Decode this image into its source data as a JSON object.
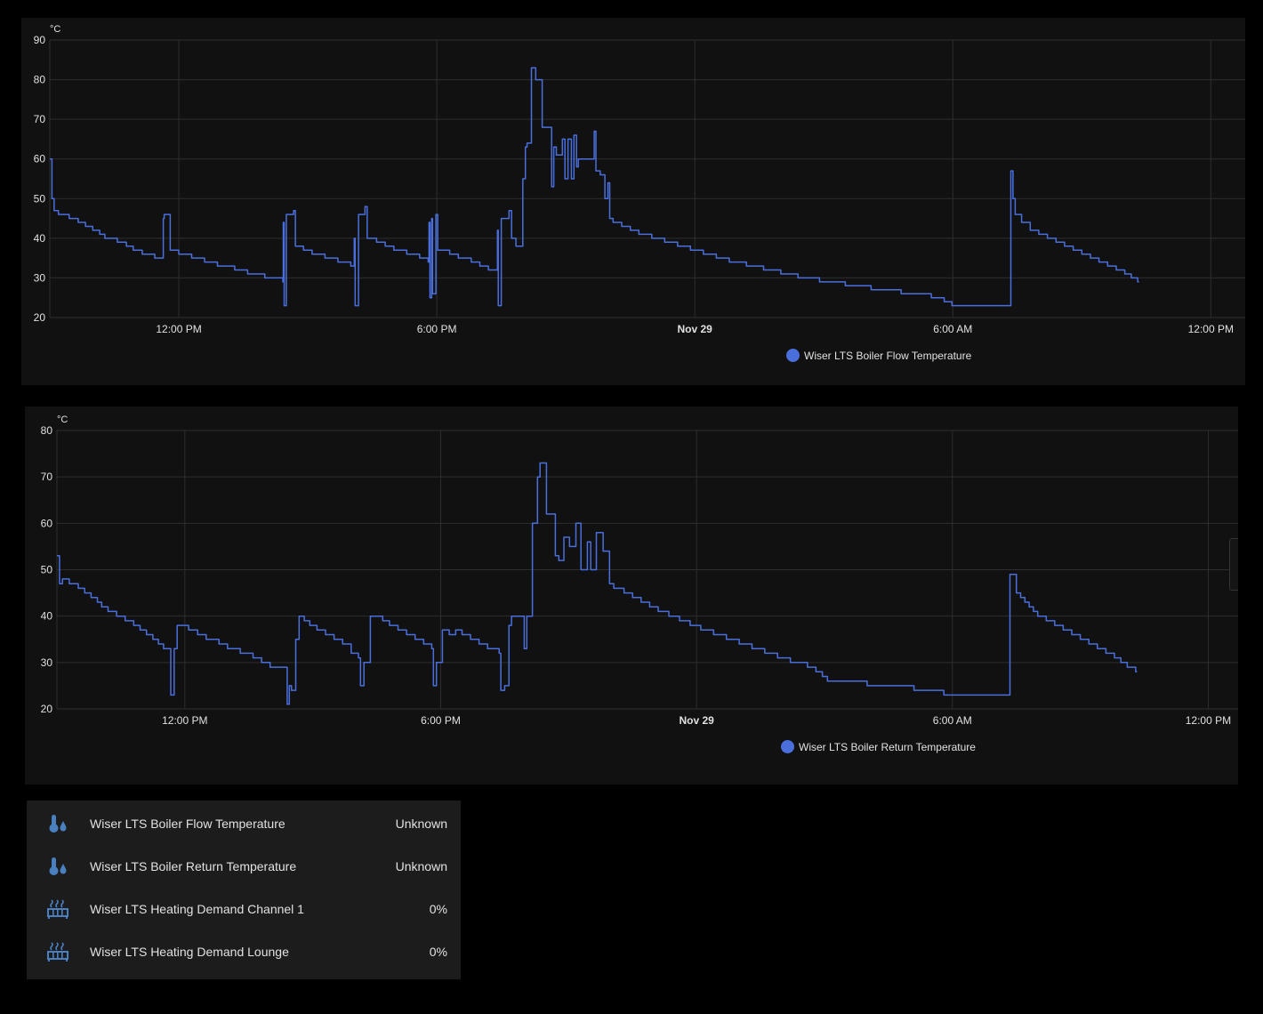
{
  "colors": {
    "series": "#4a6fdc",
    "grid": "#2e2e2e",
    "axis_text": "#e1e1e1",
    "icon": "#4a80c0"
  },
  "chart_data": [
    {
      "type": "line",
      "title": "",
      "ylabel": "°C",
      "ylim": [
        20,
        90
      ],
      "yticks": [
        20,
        30,
        40,
        50,
        60,
        70,
        80,
        90
      ],
      "x_unit": "hours since Nov 28 9:00 AM",
      "xlim": [
        0,
        27.8
      ],
      "xticks": [
        {
          "h": 3,
          "label": "12:00 PM",
          "bold": false
        },
        {
          "h": 9,
          "label": "6:00 PM",
          "bold": false
        },
        {
          "h": 15,
          "label": "Nov 29",
          "bold": true
        },
        {
          "h": 21,
          "label": "6:00 AM",
          "bold": false
        },
        {
          "h": 27,
          "label": "12:00 PM",
          "bold": false
        }
      ],
      "legend": "bottom-center",
      "series": [
        {
          "name": "Wiser LTS Boiler Flow Temperature",
          "points": [
            [
              0,
              60
            ],
            [
              0.05,
              50
            ],
            [
              0.1,
              47
            ],
            [
              0.2,
              46
            ],
            [
              0.45,
              45
            ],
            [
              0.66,
              44
            ],
            [
              0.83,
              43
            ],
            [
              1.0,
              42
            ],
            [
              1.16,
              41
            ],
            [
              1.28,
              40
            ],
            [
              1.57,
              39
            ],
            [
              1.78,
              38
            ],
            [
              1.94,
              37
            ],
            [
              2.15,
              36
            ],
            [
              2.44,
              35
            ],
            [
              2.64,
              45
            ],
            [
              2.66,
              46
            ],
            [
              2.8,
              37
            ],
            [
              3.0,
              36
            ],
            [
              3.3,
              35
            ],
            [
              3.6,
              34
            ],
            [
              3.9,
              33
            ],
            [
              4.3,
              32
            ],
            [
              4.6,
              31
            ],
            [
              5.0,
              30
            ],
            [
              5.42,
              29
            ],
            [
              5.43,
              44
            ],
            [
              5.45,
              23
            ],
            [
              5.5,
              46
            ],
            [
              5.67,
              47
            ],
            [
              5.71,
              38
            ],
            [
              5.9,
              37
            ],
            [
              6.1,
              36
            ],
            [
              6.4,
              35
            ],
            [
              6.7,
              34
            ],
            [
              7.0,
              33
            ],
            [
              7.08,
              40
            ],
            [
              7.1,
              23
            ],
            [
              7.18,
              46
            ],
            [
              7.33,
              48
            ],
            [
              7.38,
              40
            ],
            [
              7.6,
              39
            ],
            [
              7.8,
              38
            ],
            [
              8.0,
              37
            ],
            [
              8.3,
              36
            ],
            [
              8.6,
              35
            ],
            [
              8.8,
              34
            ],
            [
              8.82,
              44
            ],
            [
              8.84,
              25
            ],
            [
              8.88,
              45
            ],
            [
              8.9,
              26
            ],
            [
              8.98,
              46
            ],
            [
              9.02,
              37
            ],
            [
              9.3,
              36
            ],
            [
              9.5,
              35
            ],
            [
              9.8,
              34
            ],
            [
              10.0,
              33
            ],
            [
              10.2,
              32
            ],
            [
              10.41,
              42
            ],
            [
              10.43,
              23
            ],
            [
              10.5,
              45
            ],
            [
              10.68,
              47
            ],
            [
              10.74,
              40
            ],
            [
              10.84,
              38
            ],
            [
              11.0,
              55
            ],
            [
              11.06,
              63
            ],
            [
              11.1,
              64
            ],
            [
              11.2,
              83
            ],
            [
              11.27,
              83
            ],
            [
              11.3,
              80
            ],
            [
              11.45,
              68
            ],
            [
              11.67,
              53
            ],
            [
              11.72,
              63
            ],
            [
              11.78,
              61
            ],
            [
              11.92,
              65
            ],
            [
              11.98,
              55
            ],
            [
              12.05,
              65
            ],
            [
              12.13,
              55
            ],
            [
              12.19,
              66
            ],
            [
              12.25,
              58
            ],
            [
              12.29,
              60
            ],
            [
              12.5,
              60
            ],
            [
              12.66,
              67
            ],
            [
              12.7,
              57
            ],
            [
              12.8,
              56
            ],
            [
              12.91,
              50
            ],
            [
              12.98,
              54
            ],
            [
              13.02,
              45
            ],
            [
              13.1,
              44
            ],
            [
              13.3,
              43
            ],
            [
              13.5,
              42
            ],
            [
              13.7,
              41
            ],
            [
              14.0,
              40
            ],
            [
              14.3,
              39
            ],
            [
              14.6,
              38
            ],
            [
              14.9,
              37
            ],
            [
              15.2,
              36
            ],
            [
              15.5,
              35
            ],
            [
              15.8,
              34
            ],
            [
              16.2,
              33
            ],
            [
              16.6,
              32
            ],
            [
              17.0,
              31
            ],
            [
              17.4,
              30
            ],
            [
              17.9,
              29
            ],
            [
              18.5,
              28
            ],
            [
              19.1,
              27
            ],
            [
              19.8,
              26
            ],
            [
              20.5,
              25
            ],
            [
              20.8,
              24
            ],
            [
              20.98,
              23
            ],
            [
              22.33,
              23
            ],
            [
              22.35,
              57
            ],
            [
              22.4,
              50
            ],
            [
              22.45,
              46
            ],
            [
              22.6,
              44
            ],
            [
              22.8,
              42
            ],
            [
              23.0,
              41
            ],
            [
              23.2,
              40
            ],
            [
              23.4,
              39
            ],
            [
              23.6,
              38
            ],
            [
              23.8,
              37
            ],
            [
              24.0,
              36
            ],
            [
              24.2,
              35
            ],
            [
              24.4,
              34
            ],
            [
              24.6,
              33
            ],
            [
              24.8,
              32
            ],
            [
              25.0,
              31
            ],
            [
              25.15,
              30
            ],
            [
              25.3,
              29
            ],
            [
              25.33,
              29
            ]
          ]
        }
      ]
    },
    {
      "type": "line",
      "title": "",
      "ylabel": "°C",
      "ylim": [
        20,
        80
      ],
      "yticks": [
        20,
        30,
        40,
        50,
        60,
        70,
        80
      ],
      "x_unit": "hours since Nov 28 9:00 AM",
      "xlim": [
        0,
        27.7
      ],
      "xticks": [
        {
          "h": 3,
          "label": "12:00 PM",
          "bold": false
        },
        {
          "h": 9,
          "label": "6:00 PM",
          "bold": false
        },
        {
          "h": 15,
          "label": "Nov 29",
          "bold": true
        },
        {
          "h": 21,
          "label": "6:00 AM",
          "bold": false
        },
        {
          "h": 27,
          "label": "12:00 PM",
          "bold": false
        }
      ],
      "legend": "bottom-center",
      "series": [
        {
          "name": "Wiser LTS Boiler Return Temperature",
          "points": [
            [
              0,
              53
            ],
            [
              0.06,
              47
            ],
            [
              0.13,
              48
            ],
            [
              0.29,
              47
            ],
            [
              0.5,
              46
            ],
            [
              0.65,
              45
            ],
            [
              0.8,
              44
            ],
            [
              0.95,
              43
            ],
            [
              1.05,
              42
            ],
            [
              1.2,
              41
            ],
            [
              1.4,
              40
            ],
            [
              1.6,
              39
            ],
            [
              1.8,
              38
            ],
            [
              1.95,
              37
            ],
            [
              2.1,
              36
            ],
            [
              2.25,
              35
            ],
            [
              2.38,
              34
            ],
            [
              2.5,
              33
            ],
            [
              2.67,
              23
            ],
            [
              2.75,
              33
            ],
            [
              2.82,
              38
            ],
            [
              3.09,
              37
            ],
            [
              3.3,
              36
            ],
            [
              3.5,
              35
            ],
            [
              3.8,
              34
            ],
            [
              4.0,
              33
            ],
            [
              4.3,
              32
            ],
            [
              4.6,
              31
            ],
            [
              4.8,
              30
            ],
            [
              5.0,
              29
            ],
            [
              5.4,
              21
            ],
            [
              5.45,
              25
            ],
            [
              5.5,
              24
            ],
            [
              5.6,
              35
            ],
            [
              5.68,
              40
            ],
            [
              5.8,
              39
            ],
            [
              5.93,
              38
            ],
            [
              6.1,
              37
            ],
            [
              6.3,
              36
            ],
            [
              6.5,
              35
            ],
            [
              6.7,
              34
            ],
            [
              6.9,
              32
            ],
            [
              7.07,
              31
            ],
            [
              7.12,
              25
            ],
            [
              7.2,
              30
            ],
            [
              7.35,
              40
            ],
            [
              7.64,
              39
            ],
            [
              7.8,
              38
            ],
            [
              8.0,
              37
            ],
            [
              8.2,
              36
            ],
            [
              8.4,
              35
            ],
            [
              8.6,
              34
            ],
            [
              8.79,
              33
            ],
            [
              8.83,
              25
            ],
            [
              8.9,
              30
            ],
            [
              9.04,
              37
            ],
            [
              9.2,
              36
            ],
            [
              9.35,
              37
            ],
            [
              9.5,
              36
            ],
            [
              9.7,
              35
            ],
            [
              9.9,
              34
            ],
            [
              10.1,
              33
            ],
            [
              10.37,
              32
            ],
            [
              10.41,
              24
            ],
            [
              10.5,
              25
            ],
            [
              10.6,
              38
            ],
            [
              10.66,
              40
            ],
            [
              10.93,
              40
            ],
            [
              10.96,
              33
            ],
            [
              11.02,
              40
            ],
            [
              11.15,
              60
            ],
            [
              11.27,
              70
            ],
            [
              11.33,
              73
            ],
            [
              11.48,
              62
            ],
            [
              11.69,
              53
            ],
            [
              11.77,
              52
            ],
            [
              11.89,
              57
            ],
            [
              12.02,
              55
            ],
            [
              12.17,
              60
            ],
            [
              12.29,
              50
            ],
            [
              12.44,
              56
            ],
            [
              12.52,
              50
            ],
            [
              12.65,
              58
            ],
            [
              12.81,
              54
            ],
            [
              12.96,
              47
            ],
            [
              13.06,
              46
            ],
            [
              13.3,
              45
            ],
            [
              13.5,
              44
            ],
            [
              13.7,
              43
            ],
            [
              13.9,
              42
            ],
            [
              14.1,
              41
            ],
            [
              14.35,
              40
            ],
            [
              14.6,
              39
            ],
            [
              14.85,
              38
            ],
            [
              15.1,
              37
            ],
            [
              15.4,
              36
            ],
            [
              15.7,
              35
            ],
            [
              16.0,
              34
            ],
            [
              16.3,
              33
            ],
            [
              16.6,
              32
            ],
            [
              16.9,
              31
            ],
            [
              17.2,
              30
            ],
            [
              17.6,
              29
            ],
            [
              17.8,
              28
            ],
            [
              17.95,
              27
            ],
            [
              18.07,
              26
            ],
            [
              19.0,
              25
            ],
            [
              20.1,
              24
            ],
            [
              20.8,
              23
            ],
            [
              22.31,
              23
            ],
            [
              22.35,
              49
            ],
            [
              22.5,
              45
            ],
            [
              22.6,
              44
            ],
            [
              22.7,
              43
            ],
            [
              22.8,
              42
            ],
            [
              22.9,
              41
            ],
            [
              23.0,
              40
            ],
            [
              23.2,
              39
            ],
            [
              23.4,
              38
            ],
            [
              23.6,
              37
            ],
            [
              23.8,
              36
            ],
            [
              24.0,
              35
            ],
            [
              24.2,
              34
            ],
            [
              24.4,
              33
            ],
            [
              24.6,
              32
            ],
            [
              24.8,
              31
            ],
            [
              24.95,
              30
            ],
            [
              25.1,
              29
            ],
            [
              25.3,
              28
            ],
            [
              25.33,
              28
            ]
          ]
        }
      ]
    }
  ],
  "entities": [
    {
      "name": "Wiser LTS Boiler Flow Temperature",
      "state": "Unknown",
      "icon": "thermometer-water-icon"
    },
    {
      "name": "Wiser LTS Boiler Return Temperature",
      "state": "Unknown",
      "icon": "thermometer-water-icon"
    },
    {
      "name": "Wiser LTS Heating Demand Channel 1",
      "state": "0%",
      "icon": "radiator-icon"
    },
    {
      "name": "Wiser LTS Heating Demand Lounge",
      "state": "0%",
      "icon": "radiator-icon"
    }
  ]
}
